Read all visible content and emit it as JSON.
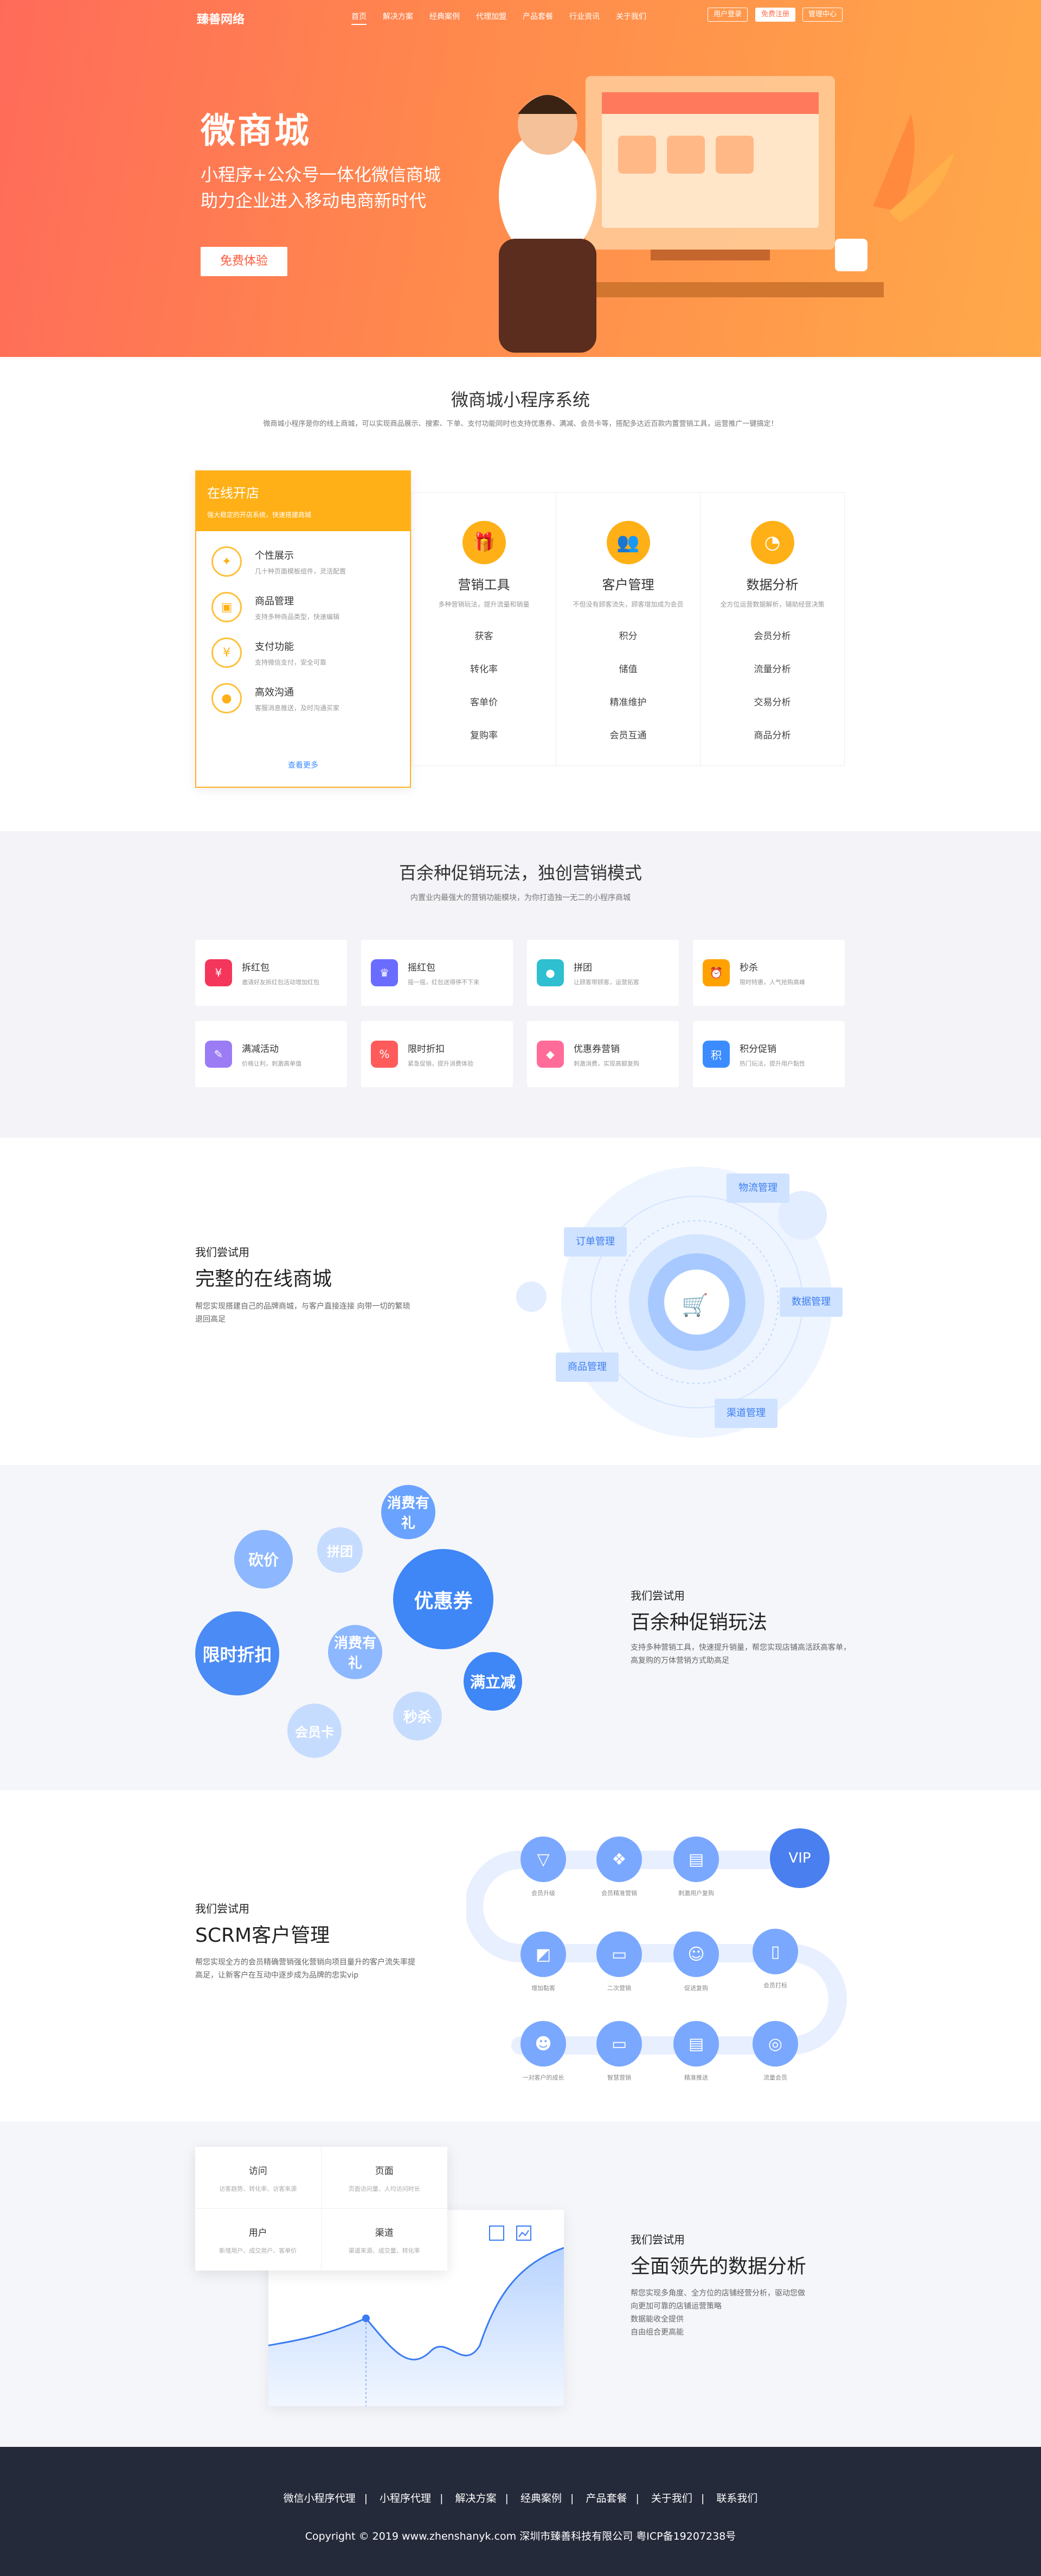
{
  "header": {
    "logo": "臻善网络",
    "nav": [
      "首页",
      "解决方案",
      "经典案例",
      "代理加盟",
      "产品套餐",
      "行业资讯",
      "关于我们"
    ],
    "btn_login": "用户登录",
    "btn_trial": "免费注册",
    "btn_console": "管理中心"
  },
  "hero": {
    "title": "微商城",
    "sub1": "小程序+公众号一体化微信商城",
    "sub2": "助力企业进入移动电商新时代",
    "cta": "免费体验"
  },
  "sys": {
    "title": "微商城小程序系统",
    "desc": "微商城小程序是你的线上商城，可以实现商品展示、搜索、下单、支付功能同时也支持优惠券、满减、会员卡等，搭配多达近百款内置营销工具，运营推广一键搞定！",
    "shop": {
      "title": "在线开店",
      "sub": "强大稳定的开店系统，快速搭建商城",
      "items": [
        {
          "name": "个性展示",
          "desc": "几十种页面模板组件，灵活配置"
        },
        {
          "name": "商品管理",
          "desc": "支持多种商品类型，快速编辑"
        },
        {
          "name": "支付功能",
          "desc": "支持微信支付，安全可靠"
        },
        {
          "name": "高效沟通",
          "desc": "客服消息推送，及时沟通买家"
        }
      ],
      "more": "查看更多"
    },
    "cols": [
      {
        "name": "营销工具",
        "desc": "多种营销玩法，提升流量和销量",
        "items": [
          "获客",
          "转化率",
          "客单价",
          "复购率"
        ],
        "icon": "gift-icon"
      },
      {
        "name": "客户管理",
        "desc": "不但没有顾客流失，顾客增加成为会员",
        "items": [
          "积分",
          "储值",
          "精准维护",
          "会员互通"
        ],
        "icon": "users-icon"
      },
      {
        "name": "数据分析",
        "desc": "全方位运营数据解析，辅助经营决策",
        "items": [
          "会员分析",
          "流量分析",
          "交易分析",
          "商品分析"
        ],
        "icon": "pie-icon"
      }
    ]
  },
  "promo": {
    "title": "百余种促销玩法，独创营销模式",
    "desc": "内置业内最强大的营销功能模块，为你打造独一无二的小程序商城",
    "cards": [
      {
        "name": "拆红包",
        "desc": "邀请好友拆红包活动增加红包",
        "color": "#f5365c",
        "icon": "¥"
      },
      {
        "name": "摇红包",
        "desc": "摇一摇，红包送得停不下来",
        "color": "#6a6cff",
        "icon": "♛"
      },
      {
        "name": "拼团",
        "desc": "让顾客带顾客，运营拓客",
        "color": "#2ebfd0",
        "icon": "●"
      },
      {
        "name": "秒杀",
        "desc": "限时特惠，人气抢购高峰",
        "color": "#ffa200",
        "icon": "⏰"
      },
      {
        "name": "满减活动",
        "desc": "价格让利，刺激高单值",
        "color": "#9b7cf5",
        "icon": "✎"
      },
      {
        "name": "限时折扣",
        "desc": "紧急促销，提升消费体验",
        "color": "#ff5b5b",
        "icon": "%"
      },
      {
        "name": "优惠券营销",
        "desc": "刺激消费，实现高额复购",
        "color": "#ff6c9a",
        "icon": "◆"
      },
      {
        "name": "积分促销",
        "desc": "热门玩法，提升用户黏性",
        "color": "#3c8cff",
        "icon": "积"
      }
    ]
  },
  "mall": {
    "kick": "我们尝试用",
    "title": "完整的在线商城",
    "desc": "帮您实现搭建自己的品牌商城，与客户直接连接 向带一切的繁琐退回高足",
    "tags": [
      "物流管理",
      "订单管理",
      "数据管理",
      "商品管理",
      "渠道管理"
    ]
  },
  "marketing": {
    "kick": "我们尝试用",
    "title": "百余种促销玩法",
    "desc": "支持多种营销工具，快速提升销量，帮您实现店铺高活跃高客单，高复购的万体营销方式助高足",
    "bubbles": [
      "消费有礼",
      "砍价",
      "拼团",
      "优惠券",
      "限时折扣",
      "消费有礼",
      "满立减",
      "会员卡",
      "秒杀"
    ]
  },
  "scrm": {
    "kick": "我们尝试用",
    "title": "SCRM客户管理",
    "desc": "帮您实现全方的会员精确营销强化营销向项目量升的客户流失率提高足，让新客户在互动中逐步成为品牌的忠实vip",
    "nodes": [
      "会员升级",
      "会员精准营销",
      "刺激用户复购",
      "VIP",
      "增加黏客",
      "二次营销",
      "促进复购",
      "会员打标",
      "一对客户的成长",
      "智慧营销",
      "精准推送",
      "流量会员"
    ]
  },
  "data": {
    "kick": "我们尝试用",
    "title": "全面领先的数据分析",
    "desc": "帮您实现多角度、全方位的店铺经营分析，驱动您做向更加可靠的店铺运营策略，数据能收全提供自由组合更高能",
    "desc_lines": [
      "帮您实现多角度、全方位的店铺经营分析，驱动您做",
      "向更加可靠的店铺运营策略",
      "数据能收全提供",
      "自由组合更高能"
    ],
    "cells": [
      {
        "h": "访问",
        "d": "访客趋势、转化率、访客来源"
      },
      {
        "h": "页面",
        "d": "页面访问量、人均访问时长"
      },
      {
        "h": "用户",
        "d": "新增用户、成交用户、客单价"
      },
      {
        "h": "渠道",
        "d": "渠道来源、成交量、转化率"
      }
    ]
  },
  "footer": {
    "nav": [
      "微信小程序代理",
      "小程序代理",
      "解决方案",
      "经典案例",
      "产品套餐",
      "关于我们",
      "联系我们"
    ],
    "copy": "Copyright © 2019 www.zhenshanyk.com 深圳市臻善科技有限公司 粤ICP备19207238号"
  }
}
